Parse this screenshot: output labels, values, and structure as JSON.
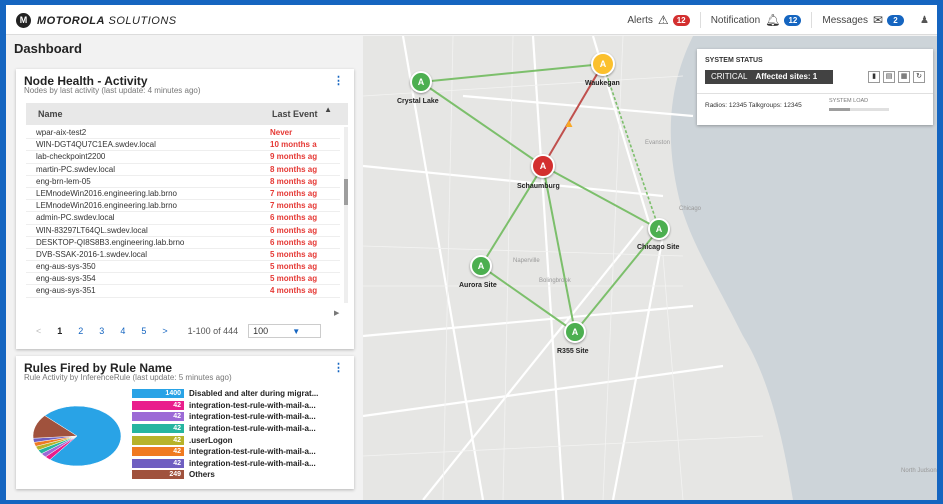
{
  "header": {
    "logo_mark": "M",
    "brand_bold": "MOTOROLA",
    "brand_rest": "SOLUTIONS",
    "alerts_label": "Alerts",
    "alerts_count": "12",
    "notification_label": "Notification",
    "notification_count": "12",
    "messages_label": "Messages",
    "messages_count": "2"
  },
  "page_title": "Dashboard",
  "node_health": {
    "title": "Node Health - Activity",
    "subtitle": "Nodes by last activity (last update: 4 minutes ago)",
    "col_name": "Name",
    "col_last": "Last Event",
    "rows": [
      {
        "name": "wpar-aix-test2",
        "last": "Never"
      },
      {
        "name": "WIN-DGT4QU7C1EA.swdev.local",
        "last": "10 months a"
      },
      {
        "name": "lab-checkpoint2200",
        "last": "9 months ag"
      },
      {
        "name": "martin-PC.swdev.local",
        "last": "8 months ag"
      },
      {
        "name": "eng-brn-lem-05",
        "last": "8 months ag"
      },
      {
        "name": "LEMnodeWin2016.engineering.lab.brno",
        "last": "7 months ag"
      },
      {
        "name": "LEMnodeWin2016.engineering.lab.brno",
        "last": "7 months ag"
      },
      {
        "name": "admin-PC.swdev.local",
        "last": "6 months ag"
      },
      {
        "name": "WIN-83297LT64QL.swdev.local",
        "last": "6 months ag"
      },
      {
        "name": "DESKTOP-QI8S8B3.engineering.lab.brno",
        "last": "6 months ag"
      },
      {
        "name": "DVB-SSAK-2016-1.swdev.local",
        "last": "5 months ag"
      },
      {
        "name": "eng-aus-sys-350",
        "last": "5 months ag"
      },
      {
        "name": "eng-aus-sys-354",
        "last": "5 months ag"
      },
      {
        "name": "eng-aus-sys-351",
        "last": "4 months ag"
      }
    ],
    "pager": {
      "prev": "<",
      "pages": [
        "1",
        "2",
        "3",
        "4",
        "5"
      ],
      "next": ">",
      "range": "1-100 of 444",
      "page_size": "100"
    }
  },
  "rules_fired": {
    "title": "Rules Fired by Rule Name",
    "subtitle": "Rule Activity by InferenceRule (last update: 5 minutes ago)",
    "items": [
      {
        "value": "1400",
        "label": "Disabled and alter during migrat...",
        "color": "#29a3e6"
      },
      {
        "value": "42",
        "label": "integration-test-rule-with-mail-a...",
        "color": "#e91e8c"
      },
      {
        "value": "42",
        "label": "integration-test-rule-with-mail-a...",
        "color": "#9c6ad6"
      },
      {
        "value": "42",
        "label": "integration-test-rule-with-mail-a...",
        "color": "#26b5a0"
      },
      {
        "value": "42",
        "label": ".userLogon",
        "color": "#b7b32a"
      },
      {
        "value": "42",
        "label": "integration-test-rule-with-mail-a...",
        "color": "#f07a21"
      },
      {
        "value": "42",
        "label": "integration-test-rule-with-mail-a...",
        "color": "#6f5fc1"
      },
      {
        "value": "249",
        "label": "Others",
        "color": "#a0523d"
      }
    ]
  },
  "map": {
    "sites": [
      {
        "id": "crystal-lake",
        "label": "Crystal Lake",
        "status": "ok"
      },
      {
        "id": "waukegan",
        "label": "Waukegan",
        "status": "warning"
      },
      {
        "id": "schaumburg",
        "label": "Schaumburg",
        "status": "critical"
      },
      {
        "id": "chicago-site",
        "label": "Chicago Site",
        "status": "ok"
      },
      {
        "id": "aurora-site",
        "label": "Aurora Site",
        "status": "ok"
      },
      {
        "id": "r355-site",
        "label": "R355 Site",
        "status": "ok"
      }
    ],
    "tower_glyph": "A",
    "towns": [
      "Evanston",
      "Chicago",
      "Naperville",
      "Bolingbrook",
      "North Judson"
    ]
  },
  "system_status": {
    "title": "SYSTEM STATUS",
    "state": "CRITICAL",
    "affected": "Affected sites: 1",
    "info": "Radios: 12345   Talkgroups: 12345",
    "load_label": "SYSTEM LOAD",
    "load_value": 0.35
  }
}
